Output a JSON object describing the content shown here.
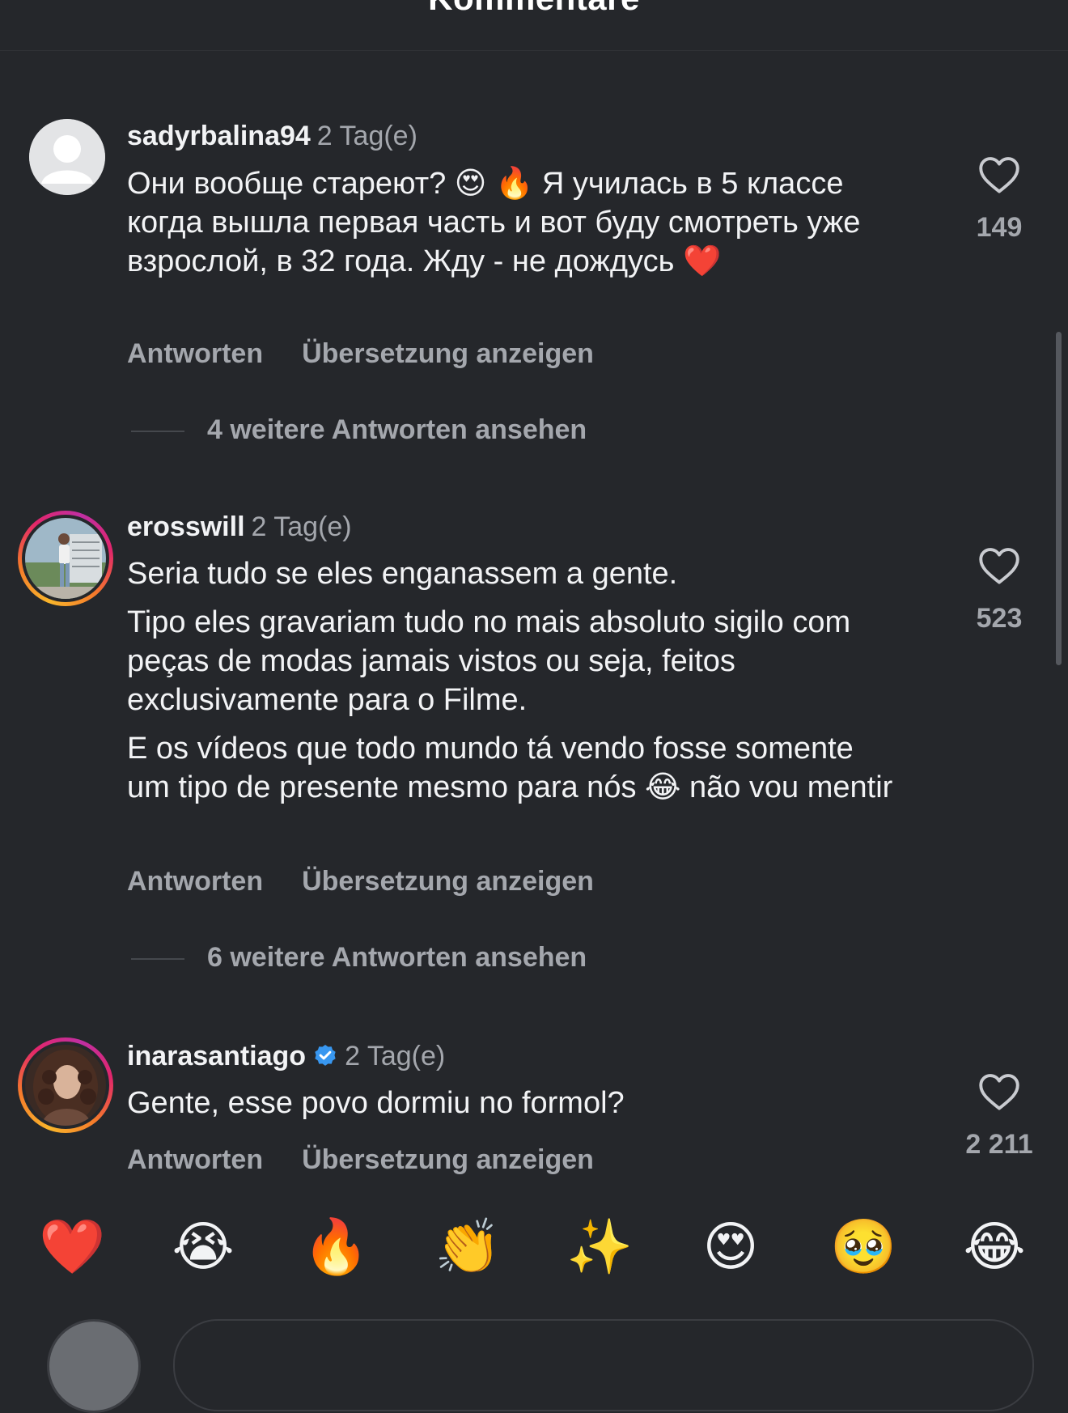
{
  "header": {
    "title": "Kommentare"
  },
  "comments": [
    {
      "username": "sadyrbalina94",
      "time": "2 Tag(e)",
      "avatar": "default-avatar",
      "paragraphs": [
        "Они вообще стареют? 😍 🔥 Я училась в 5 классе когда вышла первая часть и вот буду смотреть уже взрослой, в 32 года. Жду - не дождусь ❤️"
      ],
      "reply_label": "Antworten",
      "translate_label": "Übersetzung anzeigen",
      "more_replies": "4 weitere Antworten ansehen",
      "likes": "149",
      "verified": false
    },
    {
      "username": "erosswill",
      "time": "2 Tag(e)",
      "avatar": "story-ring-avatar",
      "paragraphs": [
        "Seria tudo se eles enganassem a gente.",
        "Tipo eles gravariam tudo no mais absoluto sigilo com peças de modas jamais vistos ou seja, feitos exclusivamente para o Filme.",
        "E os vídeos que todo mundo tá vendo fosse somente um tipo de presente mesmo para nós 😂 não vou mentir"
      ],
      "reply_label": "Antworten",
      "translate_label": "Übersetzung anzeigen",
      "more_replies": "6 weitere Antworten ansehen",
      "likes": "523",
      "verified": false
    },
    {
      "username": "inarasantiago",
      "time": "2 Tag(e)",
      "avatar": "story-ring-avatar",
      "paragraphs": [
        "Gente, esse povo dormiu no formol?"
      ],
      "reply_label": "Antworten",
      "translate_label": "Übersetzung anzeigen",
      "likes": "2 211",
      "verified": true
    }
  ],
  "emoji_bar": [
    "❤️",
    "😭",
    "🔥",
    "👏",
    "✨",
    "😍",
    "🥹",
    "😂"
  ],
  "icons": {
    "like": "heart-outline-icon",
    "verified": "verified-badge-icon"
  },
  "colors": {
    "background": "#25272b",
    "text_primary": "#f2f3f5",
    "text_secondary": "#a4a7ad",
    "verified_blue": "#3897f0"
  }
}
